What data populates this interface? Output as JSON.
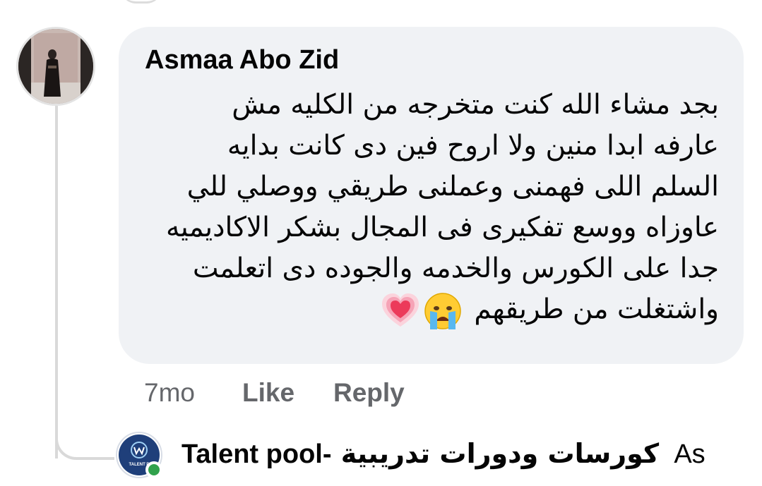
{
  "comment": {
    "author": "Asmaa Abo Zid",
    "lines": [
      "بجد مشاء الله كنت متخرجه من الكليه مش",
      "عارفه ابدا منين ولا اروح فين دى كانت بدايه",
      "السلم اللى فهمنى وعملنى طريقي ووصلي للي",
      "عاوزاه ووسع تفكيرى فى المجال بشكر الاكاديميه",
      "جدا على الكورس والخدمه والجوده دى اتعلمت",
      "واشتغلت من طريقهم"
    ],
    "trailing_emojis": [
      "crying-face-emoji",
      "beating-heart-emoji"
    ]
  },
  "actions": {
    "time": "7mo",
    "like_label": "Like",
    "reply_label": "Reply"
  },
  "reply": {
    "author_arabic": "كورسات ودورات تدريبية",
    "author_latin": "Talent pool-",
    "preview": "As",
    "avatar_text": "TALENT P",
    "online": true
  },
  "colors": {
    "bubble_bg": "#f0f2f5",
    "secondary_text": "#65676b",
    "online_green": "#31a24c"
  }
}
